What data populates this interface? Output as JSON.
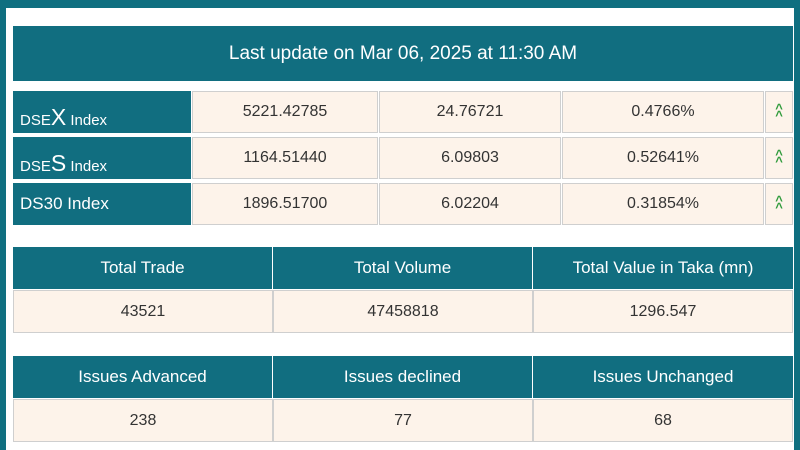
{
  "header": {
    "last_update": "Last update on Mar 06, 2025 at 11:30 AM"
  },
  "indices": [
    {
      "name_prefix": "DSE",
      "name_letter": "X",
      "name_suffix": " Index",
      "value": "5221.42785",
      "change": "24.76721",
      "percent": "0.4766%",
      "trend": "up"
    },
    {
      "name_prefix": "DSE",
      "name_letter": "S",
      "name_suffix": " Index",
      "value": "1164.51440",
      "change": "6.09803",
      "percent": "0.52641%",
      "trend": "up"
    },
    {
      "name_full": "DS30 Index",
      "value": "1896.51700",
      "change": "6.02204",
      "percent": "0.31854%",
      "trend": "up"
    }
  ],
  "trade_table": {
    "headers": [
      "Total Trade",
      "Total Volume",
      "Total Value in Taka (mn)"
    ],
    "values": [
      "43521",
      "47458818",
      "1296.547"
    ]
  },
  "issues_table": {
    "headers": [
      "Issues Advanced",
      "Issues declined",
      "Issues Unchanged"
    ],
    "values": [
      "238",
      "77",
      "68"
    ]
  },
  "colors": {
    "header_bg": "#116e80",
    "cell_bg": "#fdf3ea",
    "up_arrow": "#2e9a3a",
    "page_bg": "#0f6f80"
  }
}
